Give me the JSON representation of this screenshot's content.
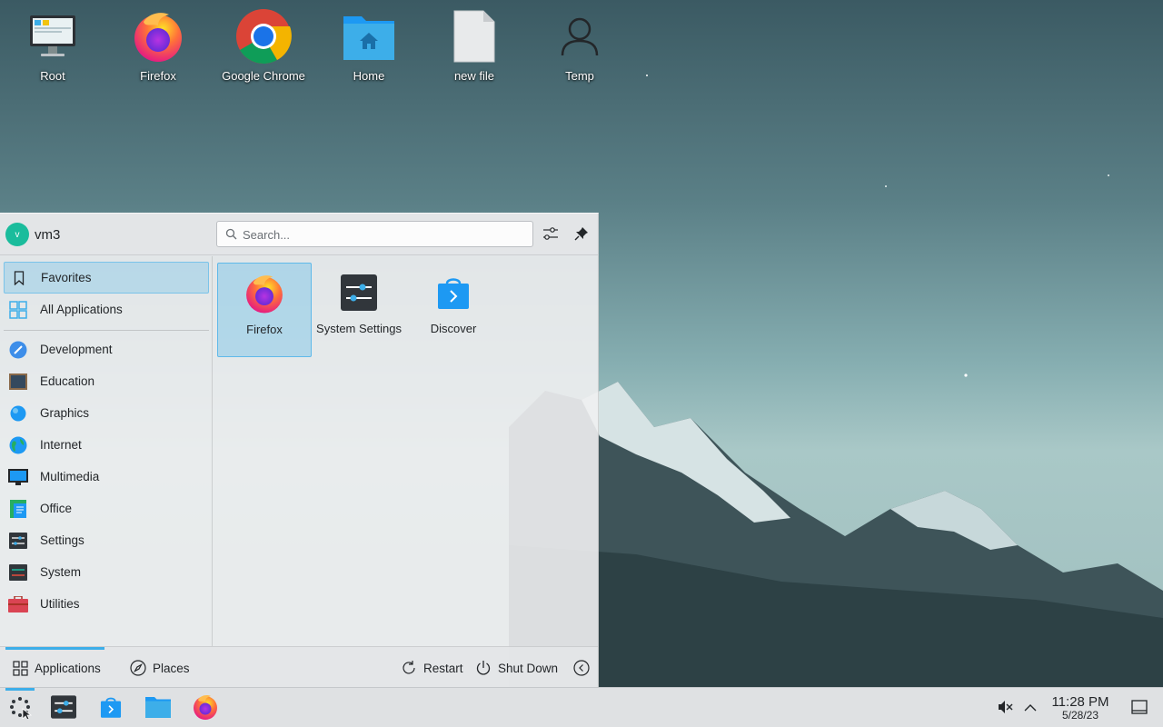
{
  "desktop": {
    "icons": [
      {
        "label": "Root",
        "icon": "computer-icon"
      },
      {
        "label": "Firefox",
        "icon": "firefox-icon"
      },
      {
        "label": "Google Chrome",
        "icon": "chrome-icon"
      },
      {
        "label": "Home",
        "icon": "home-folder-icon"
      },
      {
        "label": "new file",
        "icon": "file-icon"
      },
      {
        "label": "Temp",
        "icon": "user-icon"
      }
    ]
  },
  "launcher": {
    "user": {
      "name": "vm3",
      "initial": "v",
      "avatar_color": "#1abc9c"
    },
    "search": {
      "placeholder": "Search..."
    },
    "sidebar": {
      "top_items": [
        {
          "label": "Favorites",
          "icon": "bookmark-icon",
          "active": true
        },
        {
          "label": "All Applications",
          "icon": "grid-apps-icon"
        }
      ],
      "categories": [
        {
          "label": "Development",
          "icon": "development-icon"
        },
        {
          "label": "Education",
          "icon": "education-icon"
        },
        {
          "label": "Graphics",
          "icon": "graphics-icon"
        },
        {
          "label": "Internet",
          "icon": "internet-globe-icon"
        },
        {
          "label": "Multimedia",
          "icon": "multimedia-icon"
        },
        {
          "label": "Office",
          "icon": "office-icon"
        },
        {
          "label": "Settings",
          "icon": "settings-icon"
        },
        {
          "label": "System",
          "icon": "system-icon"
        },
        {
          "label": "Utilities",
          "icon": "utilities-toolbox-icon"
        }
      ]
    },
    "favorites": [
      {
        "label": "Firefox",
        "icon": "firefox-icon",
        "active": true
      },
      {
        "label": "System Settings",
        "icon": "system-settings-icon"
      },
      {
        "label": "Discover",
        "icon": "discover-icon"
      }
    ],
    "footer": {
      "applications_label": "Applications",
      "places_label": "Places",
      "restart_label": "Restart",
      "shutdown_label": "Shut Down"
    }
  },
  "taskbar": {
    "items": [
      {
        "name": "application-launcher",
        "icon": "launcher-icon",
        "active": true
      },
      {
        "name": "system-settings",
        "icon": "system-settings-icon"
      },
      {
        "name": "discover",
        "icon": "discover-icon"
      },
      {
        "name": "file-manager",
        "icon": "folder-icon"
      },
      {
        "name": "firefox",
        "icon": "firefox-icon"
      }
    ],
    "tray": {
      "volume_state": "muted",
      "time": "11:28 PM",
      "date": "5/28/23"
    }
  },
  "colors": {
    "accent": "#3daee9",
    "launcher_bg": "#eff0f1",
    "taskbar_bg": "#dfe1e3"
  }
}
